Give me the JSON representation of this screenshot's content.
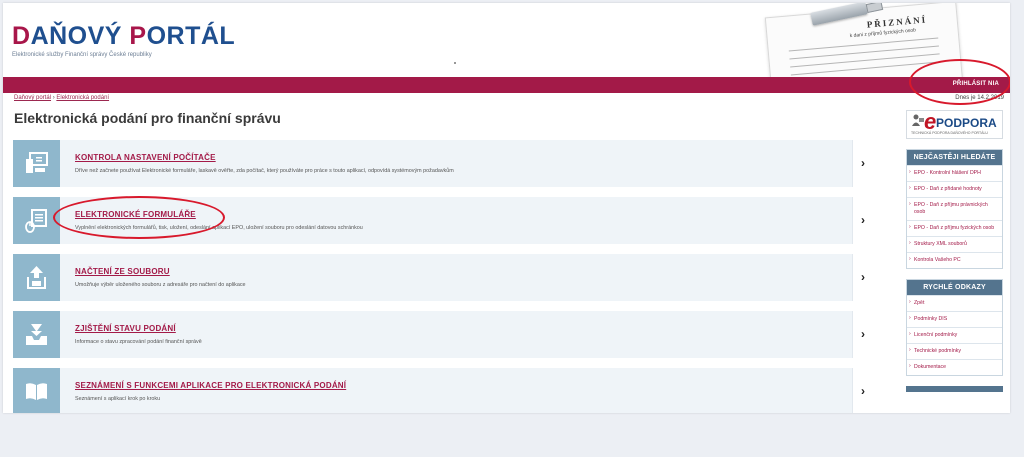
{
  "header": {
    "logo_part1": "D",
    "logo_part2": "AŇOVÝ ",
    "logo_part3": "P",
    "logo_part4": "ORTÁL",
    "logo_subtitle": "Elektronické služby Finanční správy České republiky",
    "banner_title": "PŘIZNÁNÍ",
    "banner_subtitle": "k dani z příjmů fyzických osob"
  },
  "topbar": {
    "login_label": "PŘIHLÁSIT NIA"
  },
  "breadcrumb": {
    "item1": "Daňový portál",
    "separator": "›",
    "item2": "Elektronická podání"
  },
  "date_text": "Dnes je 14.2.2019",
  "page_title": "Elektronická podání pro finanční správu",
  "cards": [
    {
      "title": "KONTROLA NASTAVENÍ POČÍTAČE",
      "description": "Dříve než začnete používat Elektronické formuláře, laskavě ověřte, zda počítač, který používáte pro práce s touto aplikací, odpovídá systémovým požadavkům",
      "icon": "computer-icon"
    },
    {
      "title": "ELEKTRONICKÉ FORMULÁŘE",
      "description": "Vyplnění elektronických formulářů, tisk, uložení, odeslání aplikací EPO, uložení souboru pro odeslání datovou schránkou",
      "icon": "form-mouse-icon"
    },
    {
      "title": "NAČTENÍ ZE SOUBORU",
      "description": "Umožňuje výběr uloženého souboru z adresáře pro načtení do aplikace",
      "icon": "upload-icon"
    },
    {
      "title": "ZJIŠTĚNÍ STAVU PODÁNÍ",
      "description": "Informace o stavu zpracování podání finanční správě",
      "icon": "inbox-icon"
    },
    {
      "title": "SEZNÁMENÍ S FUNKCEMI APLIKACE PRO ELEKTRONICKÁ PODÁNÍ",
      "description": "Seznámení s aplikací krok po kroku",
      "icon": "book-icon"
    }
  ],
  "arrow_glyph": "›",
  "epodpora": {
    "letter": "e",
    "text": "PODPORA",
    "subtitle": "TECHNICKÁ PODPORA DAŇOVÉHO PORTÁLU"
  },
  "most_searched": {
    "heading": "NEJČASTĚJI HLEDÁTE",
    "items": [
      "EPO - Kontrolní hlášení DPH",
      "EPO - Daň z přidané hodnoty",
      "EPO - Daň z příjmu právnických osob",
      "EPO - Daň z příjmu fyzických osob",
      "Struktury XML souborů",
      "Kontrola Vašeho PC"
    ]
  },
  "quick_links": {
    "heading": "RYCHLÉ ODKAZY",
    "items": [
      "Zpět",
      "Podmínky DIS",
      "Licenční podmínky",
      "Technické podmínky",
      "Dokumentace"
    ]
  },
  "colors": {
    "brand_red": "#a31a48",
    "brand_blue": "#1f4f8f",
    "icon_tile": "#8fb7cc",
    "card_bg": "#eff4f8",
    "sidebar_head": "#54748e",
    "annotation_red": "#d8192c"
  }
}
